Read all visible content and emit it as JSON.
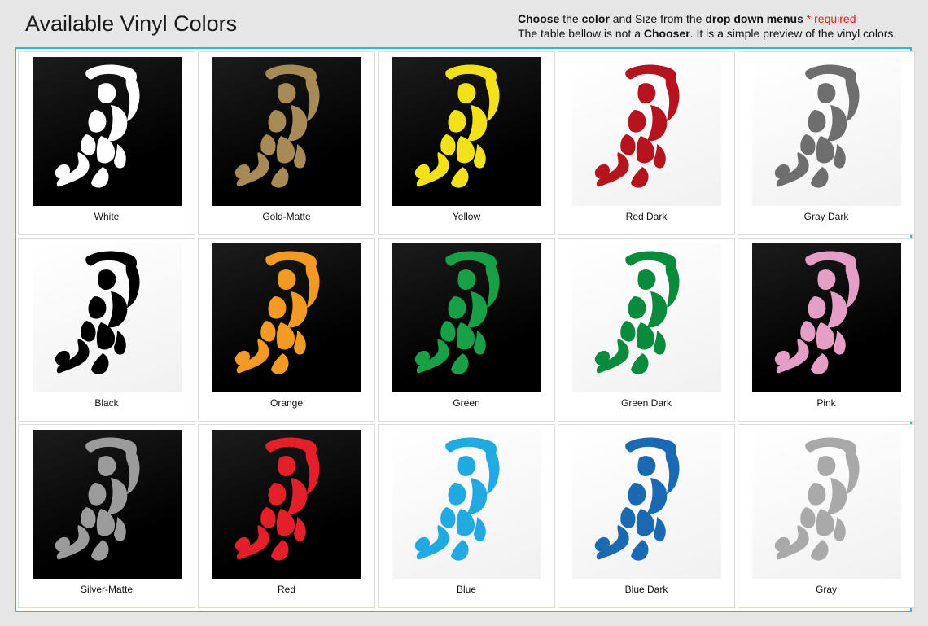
{
  "header": {
    "title": "Available Vinyl Colors",
    "line1": {
      "w1": "Choose",
      "t1": " the ",
      "w2": "color",
      "t2": " and Size from the ",
      "w3": "drop down menus",
      "required": "* required"
    },
    "line2": {
      "t1": "The table bellow is not a ",
      "w1": "Chooser",
      "t2": ". It is a simple preview of the vinyl colors."
    }
  },
  "colors": [
    {
      "label": "White",
      "fill": "#ffffff",
      "bg": "dark"
    },
    {
      "label": "Gold-Matte",
      "fill": "#a78a55",
      "bg": "dark"
    },
    {
      "label": "Yellow",
      "fill": "#f2e11a",
      "bg": "dark"
    },
    {
      "label": "Red Dark",
      "fill": "#b5141f",
      "bg": "light"
    },
    {
      "label": "Gray Dark",
      "fill": "#6e6e6e",
      "bg": "light"
    },
    {
      "label": "Black",
      "fill": "#000000",
      "bg": "light"
    },
    {
      "label": "Orange",
      "fill": "#f39a24",
      "bg": "dark"
    },
    {
      "label": "Green",
      "fill": "#17a046",
      "bg": "dark"
    },
    {
      "label": "Green Dark",
      "fill": "#0a8a3c",
      "bg": "light"
    },
    {
      "label": "Pink",
      "fill": "#e59fc7",
      "bg": "dark"
    },
    {
      "label": "Silver-Matte",
      "fill": "#9b9b9b",
      "bg": "dark"
    },
    {
      "label": "Red",
      "fill": "#e3202a",
      "bg": "dark"
    },
    {
      "label": "Blue",
      "fill": "#21a9e1",
      "bg": "light"
    },
    {
      "label": "Blue Dark",
      "fill": "#1b68b3",
      "bg": "light"
    },
    {
      "label": "Gray",
      "fill": "#a9a9a9",
      "bg": "light"
    }
  ]
}
